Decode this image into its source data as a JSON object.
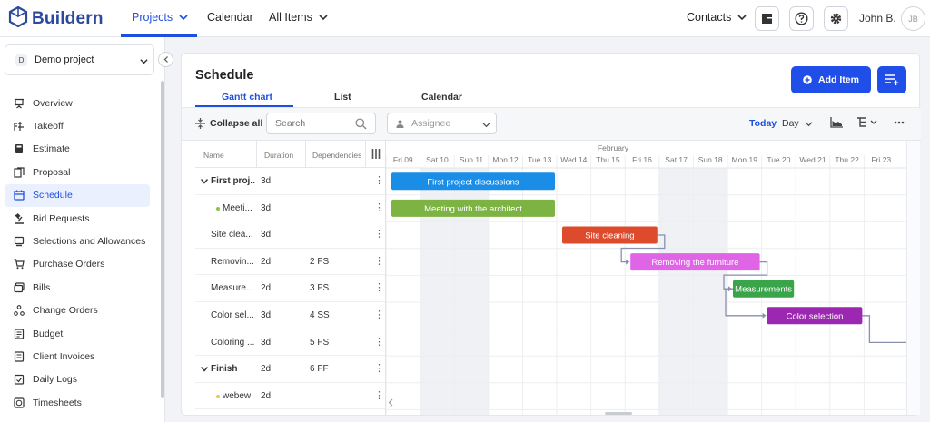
{
  "app": {
    "name": "Buildern"
  },
  "topnav": {
    "items": [
      {
        "label": "Projects",
        "dropdown": true,
        "active": true
      },
      {
        "label": "Calendar",
        "dropdown": false,
        "active": false
      },
      {
        "label": "All Items",
        "dropdown": true,
        "active": false
      }
    ],
    "contacts_label": "Contacts",
    "user_name": "John B.",
    "user_initials": "JB"
  },
  "sidebar": {
    "project": {
      "badge": "D",
      "name": "Demo project"
    },
    "items": [
      {
        "label": "Overview",
        "icon": "presentation-icon",
        "active": false
      },
      {
        "label": "Takeoff",
        "icon": "takeoff-icon",
        "active": false
      },
      {
        "label": "Estimate",
        "icon": "calculator-icon",
        "active": false
      },
      {
        "label": "Proposal",
        "icon": "proposal-icon",
        "active": false
      },
      {
        "label": "Schedule",
        "icon": "calendar-icon",
        "active": true
      },
      {
        "label": "Bid Requests",
        "icon": "bid-icon",
        "active": false
      },
      {
        "label": "Selections and Allowances",
        "icon": "selections-icon",
        "active": false
      },
      {
        "label": "Purchase Orders",
        "icon": "cart-icon",
        "active": false
      },
      {
        "label": "Bills",
        "icon": "bills-icon",
        "active": false
      },
      {
        "label": "Change Orders",
        "icon": "change-orders-icon",
        "active": false
      },
      {
        "label": "Budget",
        "icon": "budget-icon",
        "active": false
      },
      {
        "label": "Client Invoices",
        "icon": "invoice-icon",
        "active": false
      },
      {
        "label": "Daily Logs",
        "icon": "daily-log-icon",
        "active": false
      },
      {
        "label": "Timesheets",
        "icon": "timesheet-icon",
        "active": false
      }
    ]
  },
  "schedule": {
    "title": "Schedule",
    "tabs": [
      {
        "label": "Gantt chart",
        "active": true
      },
      {
        "label": "List",
        "active": false
      },
      {
        "label": "Calendar",
        "active": false
      }
    ],
    "add_item_label": "Add Item",
    "toolbar": {
      "collapse_all_label": "Collapse all",
      "search_placeholder": "Search",
      "assignee_placeholder": "Assignee",
      "today_label": "Today",
      "scale_label": "Day"
    },
    "grid": {
      "columns": [
        "Name",
        "Duration",
        "Dependencies"
      ],
      "rows": [
        {
          "name": "First proj...",
          "duration": "3d",
          "deps": "",
          "group": true,
          "dot": ""
        },
        {
          "name": "Meeti...",
          "duration": "3d",
          "deps": "",
          "group": false,
          "dot": "#8bc34a",
          "indent": 2
        },
        {
          "name": "Site clea...",
          "duration": "3d",
          "deps": "",
          "group": false,
          "dot": "",
          "indent": 1
        },
        {
          "name": "Removin...",
          "duration": "2d",
          "deps": "2 FS",
          "group": false,
          "dot": "",
          "indent": 1
        },
        {
          "name": "Measure...",
          "duration": "2d",
          "deps": "3 FS",
          "group": false,
          "dot": "",
          "indent": 1
        },
        {
          "name": "Color sel...",
          "duration": "3d",
          "deps": "4 SS",
          "group": false,
          "dot": "",
          "indent": 1
        },
        {
          "name": "Coloring ...",
          "duration": "3d",
          "deps": "5 FS",
          "group": false,
          "dot": "",
          "indent": 1
        },
        {
          "name": "Finish",
          "duration": "2d",
          "deps": "6 FF",
          "group": true,
          "dot": ""
        },
        {
          "name": "webew",
          "duration": "2d",
          "deps": "",
          "group": false,
          "dot": "#e6c84a",
          "indent": 2
        }
      ]
    },
    "gantt": {
      "month_label": "February",
      "days": [
        "Fri 09",
        "Sat 10",
        "Sun 11",
        "Mon 12",
        "Tue 13",
        "Wed 14",
        "Thu 15",
        "Fri 16",
        "Sat 17",
        "Sun 18",
        "Mon 19",
        "Tue 20",
        "Wed 21",
        "Thu 22",
        "Fri 23"
      ],
      "weekend_indices": [
        1,
        2,
        8,
        9
      ],
      "tasks": [
        {
          "label": "First project discussions",
          "row": 0,
          "start": 0,
          "days": 5,
          "color": "#1a8ee6"
        },
        {
          "label": "Meeting with the architect",
          "row": 1,
          "start": 0,
          "days": 5,
          "color": "#7cb342"
        },
        {
          "label": "Site cleaning",
          "row": 2,
          "start": 5,
          "days": 3,
          "color": "#dd4b2c"
        },
        {
          "label": "Removing the furniture",
          "row": 3,
          "start": 7,
          "days": 4,
          "color": "#e065e6"
        },
        {
          "label": "Measurements",
          "row": 4,
          "start": 10,
          "days": 2,
          "color": "#3aa44a"
        },
        {
          "label": "Color selection",
          "row": 5,
          "start": 11,
          "days": 3,
          "color": "#9c27b0"
        }
      ],
      "links": [
        {
          "from": 2,
          "to": 3,
          "type": "FS"
        },
        {
          "from": 3,
          "to": 4,
          "type": "FS"
        },
        {
          "from": 4,
          "to": 5,
          "type": "SS"
        },
        {
          "from": 5,
          "to": 6,
          "type": "FS"
        }
      ]
    }
  }
}
